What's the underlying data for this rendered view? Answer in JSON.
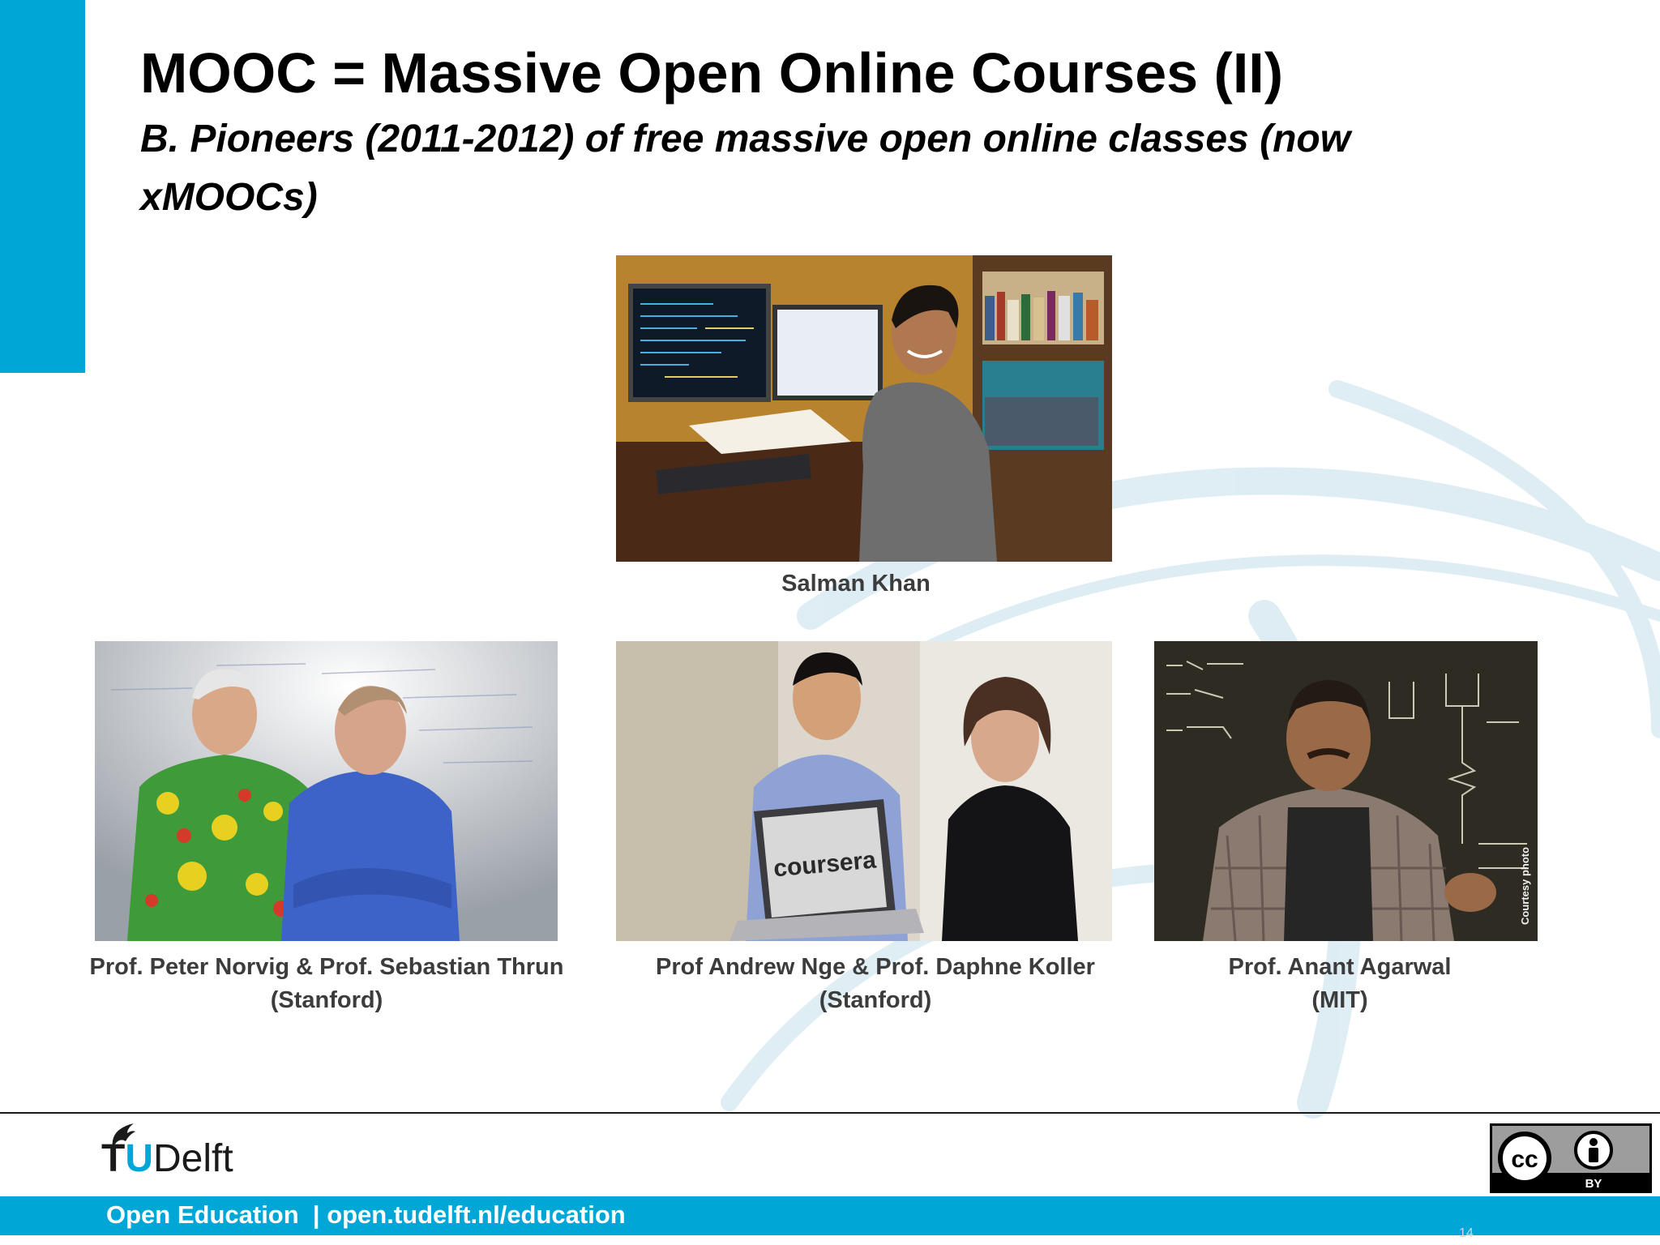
{
  "slide": {
    "title": "MOOC = Massive Open Online Courses (II)",
    "subtitle": "B. Pioneers (2011-2012) of free massive open online classes (now xMOOCs)",
    "page_number": "14"
  },
  "photos": [
    {
      "name": "salman-khan-photo",
      "caption_line1": "Salman Khan",
      "caption_line2": ""
    },
    {
      "name": "norvig-thrun-photo",
      "caption_line1": "Prof. Peter Norvig & Prof. Sebastian Thrun",
      "caption_line2": "(Stanford)"
    },
    {
      "name": "ng-koller-photo",
      "caption_line1": "Prof Andrew Nge & Prof. Daphne Koller",
      "caption_line2": "(Stanford)",
      "laptop_text": "coursera"
    },
    {
      "name": "agarwal-photo",
      "caption_line1": "Prof. Anant Agarwal",
      "caption_line2": "(MIT)",
      "photo_credit": "Courtesy photo"
    }
  ],
  "footer": {
    "logo_t": "T",
    "logo_u": "U",
    "logo_delft": "Delft",
    "text": "Open Education  | open.tudelft.nl/education",
    "license_label": "BY",
    "license_icon": "creative-commons-by-icon"
  },
  "colors": {
    "accent": "#00a6d6",
    "title": "#000000",
    "caption": "#3c3c3c"
  }
}
